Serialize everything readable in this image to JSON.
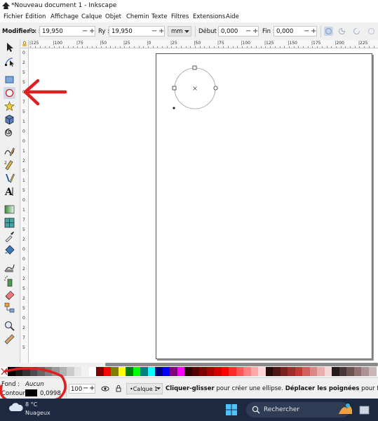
{
  "window": {
    "title": "*Nouveau document 1 - Inkscape"
  },
  "menu": [
    "Fichier",
    "Édition",
    "Affichage",
    "Calque",
    "Objet",
    "Chemin",
    "Texte",
    "Filtres",
    "Extensions",
    "Aide"
  ],
  "toolbar": {
    "modify_label": "Modifier :",
    "rx_label": "Rx :",
    "rx_value": "19,950",
    "ry_label": "Ry :",
    "ry_value": "19,950",
    "unit": "mm",
    "start_label": "Début :",
    "start_value": "0,000",
    "end_label": "Fin :",
    "end_value": "0,000",
    "minus": "−",
    "plus": "+"
  },
  "ruler": {
    "h_ticks": [
      "|125",
      "|100",
      "|75",
      "|50",
      "|25",
      "|0",
      "|25",
      "|50",
      "|75",
      "|100",
      "|125",
      "|150",
      "|175",
      "|200",
      "|225"
    ],
    "v_ticks": [
      "0",
      "2",
      "5",
      "5",
      "0",
      "7",
      "5",
      "1",
      "0",
      "0",
      "1",
      "2",
      "5",
      "1",
      "5",
      "0",
      "1",
      "7",
      "5",
      "2",
      "0",
      "0",
      "2",
      "2",
      "5",
      "2",
      "5",
      "0",
      "2",
      "7",
      "5"
    ]
  },
  "tools": [
    "selector-icon",
    "node-icon",
    "rectangle-icon",
    "ellipse-icon",
    "star-icon",
    "3d-box-icon",
    "spiral-icon",
    "pencil-icon",
    "pen-icon",
    "calligraphy-icon",
    "text-icon",
    "gradient-icon",
    "mesh-icon",
    "dropper-icon",
    "paint-bucket-icon",
    "tweak-icon",
    "spray-icon",
    "eraser-icon",
    "connector-icon",
    "zoom-icon",
    "measure-icon"
  ],
  "status": {
    "fill_label": "Fond :",
    "fill_value": "Aucun",
    "stroke_label": "Contour :",
    "stroke_width": "0,0998",
    "zoom": "100",
    "layer": "•Calque 1",
    "hint_bold1": "Cliquer-glisser",
    "hint_text1": " pour créer une ellipse. ",
    "hint_bold2": "Déplacer les poignées",
    "hint_text2": " pour fa"
  },
  "taskbar": {
    "weather_temp": "8 °C",
    "weather_desc": "Nuageux",
    "search": "Rechercher"
  },
  "colors": {
    "annotation_red": "#e02020",
    "accent_blue": "#3c6ec8",
    "taskbar_bg": "#1c2940"
  },
  "palette": [
    "#000000",
    "#1a1a1a",
    "#333333",
    "#4d4d4d",
    "#666666",
    "#808080",
    "#999999",
    "#b3b3b3",
    "#cccccc",
    "#e6e6e6",
    "#f2f2f2",
    "#ffffff",
    "#800000",
    "#ff0000",
    "#808000",
    "#ffff00",
    "#008000",
    "#00ff00",
    "#008080",
    "#00ffff",
    "#000080",
    "#0000ff",
    "#800080",
    "#ff00ff",
    "#2b0000",
    "#550000",
    "#800000",
    "#aa0000",
    "#d40000",
    "#ff0000",
    "#ff2a2a",
    "#ff5555",
    "#ff8080",
    "#ffaaaa",
    "#ffd5d5",
    "#280b0b",
    "#501616",
    "#782121",
    "#a02c2c",
    "#c83737",
    "#d35f5f",
    "#de8787",
    "#e9afaf",
    "#f4d7d7",
    "#241c1c",
    "#483737",
    "#6c5353",
    "#916f6f",
    "#ac9393",
    "#c8b7b7"
  ]
}
